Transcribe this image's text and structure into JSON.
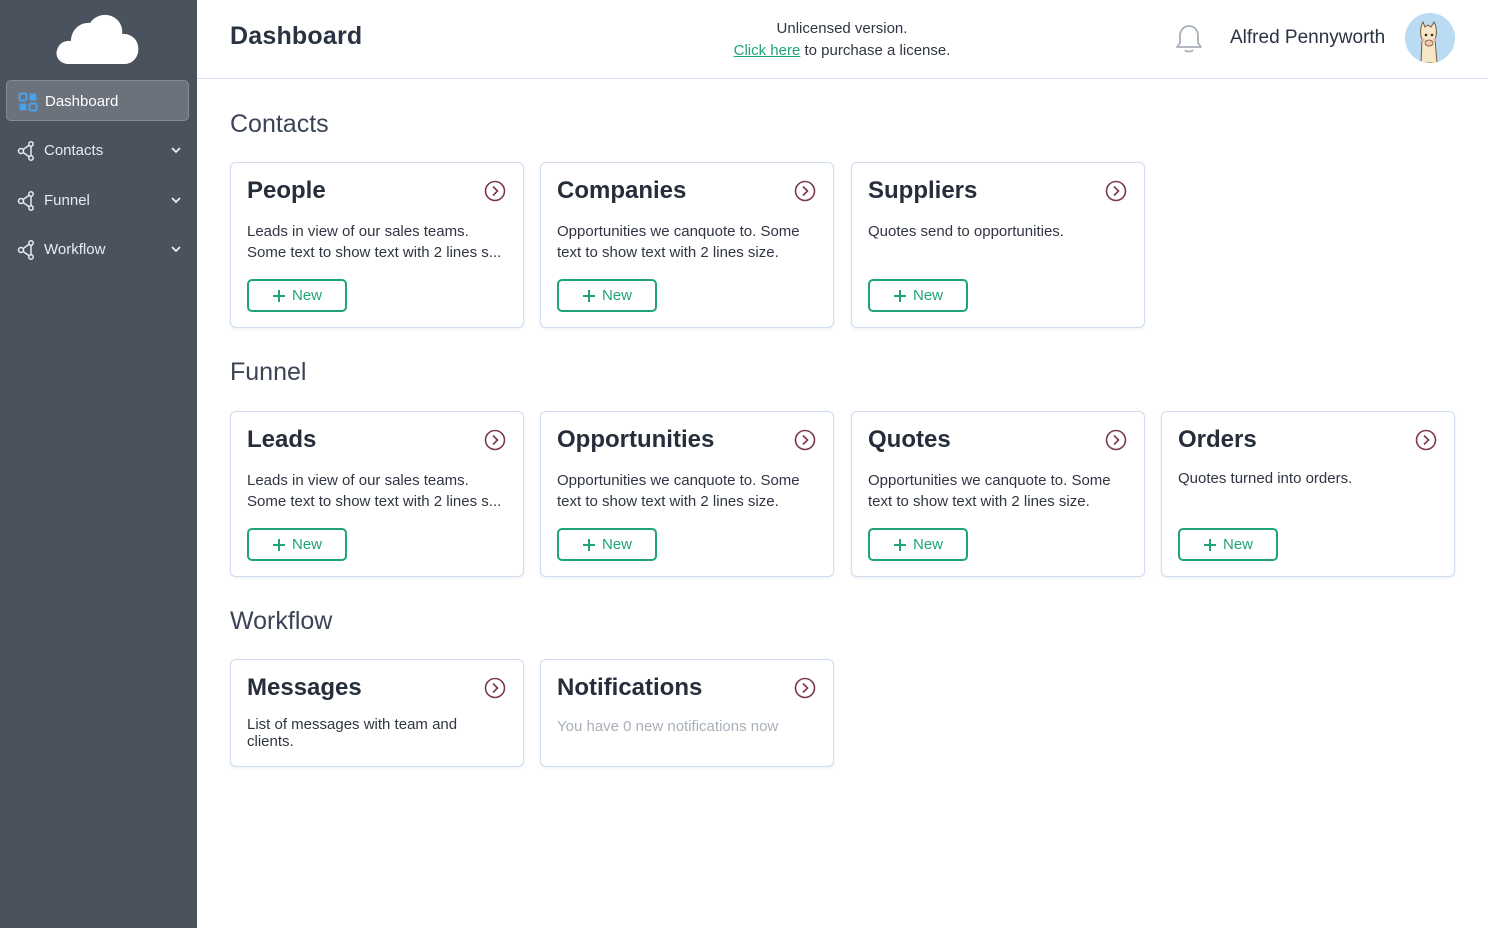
{
  "sidebar": {
    "logo": "cloud-logo",
    "items": [
      {
        "label": "Dashboard",
        "icon": "grid-icon",
        "active": true
      },
      {
        "label": "Contacts",
        "icon": "share-nodes-icon",
        "expandable": true
      },
      {
        "label": "Funnel",
        "icon": "share-nodes-icon",
        "expandable": true
      },
      {
        "label": "Workflow",
        "icon": "share-nodes-icon",
        "expandable": true
      }
    ]
  },
  "header": {
    "title": "Dashboard",
    "license_line1": "Unlicensed version.",
    "license_link": "Click here",
    "license_line2": " to purchase a license.",
    "user_name": "Alfred Pennyworth"
  },
  "sections": [
    {
      "title": "Contacts",
      "cards": [
        {
          "title": "People",
          "desc1": "Leads in view of our sales teams.",
          "desc2": "Some text to show text with 2 lines s...",
          "button": "New"
        },
        {
          "title": "Companies",
          "desc1": "Opportunities we canquote to. Some",
          "desc2": "text to show text with 2 lines size.",
          "button": "New"
        },
        {
          "title": "Suppliers",
          "desc1": "Quotes send to opportunities.",
          "desc2": "",
          "button": "New"
        }
      ]
    },
    {
      "title": "Funnel",
      "cards": [
        {
          "title": "Leads",
          "desc1": "Leads in view of our sales teams.",
          "desc2": "Some text to show text with 2 lines s...",
          "button": "New"
        },
        {
          "title": "Opportunities",
          "desc1": "Opportunities we canquote to. Some",
          "desc2": "text to show text with 2 lines size.",
          "button": "New"
        },
        {
          "title": "Quotes",
          "desc1": "Opportunities we canquote to. Some",
          "desc2": "text to show text with 2 lines size.",
          "button": "New"
        },
        {
          "title": "Orders",
          "desc1": "Quotes turned into orders.",
          "desc2": "",
          "button": "New"
        }
      ]
    },
    {
      "title": "Workflow",
      "cards": [
        {
          "title": "Messages",
          "desc": "List of messages with team and clients."
        },
        {
          "title": "Notifications",
          "desc": "You have 0 new notifications now"
        }
      ]
    }
  ],
  "colors": {
    "sidebar_bg": "#4a525d",
    "accent_green": "#1fa37a",
    "go_icon": "#7a3a4a",
    "card_border": "#cfdded"
  }
}
